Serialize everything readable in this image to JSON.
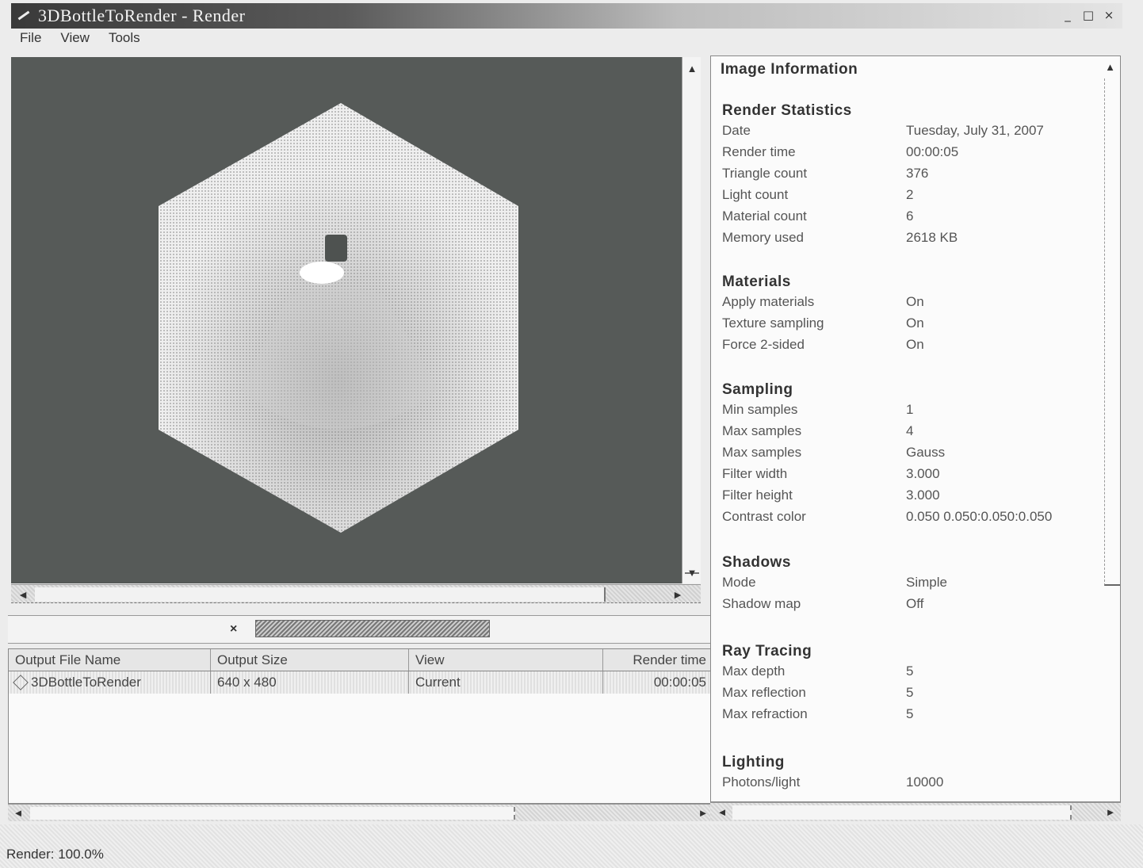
{
  "window": {
    "title": "3DBottleToRender - Render",
    "controls": [
      "_",
      "□",
      "×"
    ]
  },
  "menu": [
    "File",
    "View",
    "Tools"
  ],
  "viewport": {
    "background_color": "#565a58",
    "object_color": "#e8e8e8"
  },
  "output_table": {
    "columns": [
      "Output File Name",
      "Output Size",
      "View",
      "Render time"
    ],
    "rows": [
      {
        "file_name": "3DBottleToRender",
        "size": "640 x 480",
        "view": "Current",
        "render_time": "00:00:05"
      }
    ]
  },
  "progress": {
    "cancel_label": "×",
    "fraction": 1.0
  },
  "info_panel": {
    "title": "Image Information",
    "sections": [
      {
        "heading": "Render Statistics",
        "items": [
          {
            "k": "Date",
            "v": "Tuesday, July 31, 2007"
          },
          {
            "k": "Render time",
            "v": "00:00:05"
          },
          {
            "k": "Triangle count",
            "v": "376"
          },
          {
            "k": "Light count",
            "v": "2"
          },
          {
            "k": "Material count",
            "v": "6"
          },
          {
            "k": "Memory used",
            "v": "2618 KB"
          }
        ]
      },
      {
        "heading": "Materials",
        "items": [
          {
            "k": "Apply materials",
            "v": "On"
          },
          {
            "k": "Texture sampling",
            "v": "On"
          },
          {
            "k": "Force 2-sided",
            "v": "On"
          }
        ]
      },
      {
        "heading": "Sampling",
        "items": [
          {
            "k": "Min samples",
            "v": "1"
          },
          {
            "k": "Max samples",
            "v": "4"
          },
          {
            "k": "Max samples",
            "v": "Gauss"
          },
          {
            "k": "Filter width",
            "v": "3.000"
          },
          {
            "k": "Filter height",
            "v": "3.000"
          },
          {
            "k": "Contrast color",
            "v": "0.050 0.050:0.050:0.050"
          }
        ]
      },
      {
        "heading": "Shadows",
        "items": [
          {
            "k": "Mode",
            "v": "Simple"
          },
          {
            "k": "Shadow map",
            "v": "Off"
          }
        ]
      },
      {
        "heading": "Ray Tracing",
        "items": [
          {
            "k": "Max depth",
            "v": "5"
          },
          {
            "k": "Max reflection",
            "v": "5"
          },
          {
            "k": "Max refraction",
            "v": "5"
          }
        ]
      },
      {
        "heading": "Lighting",
        "items": [
          {
            "k": "Photons/light",
            "v": "10000"
          }
        ]
      }
    ]
  },
  "status": {
    "text": "Render: 100.0%"
  }
}
